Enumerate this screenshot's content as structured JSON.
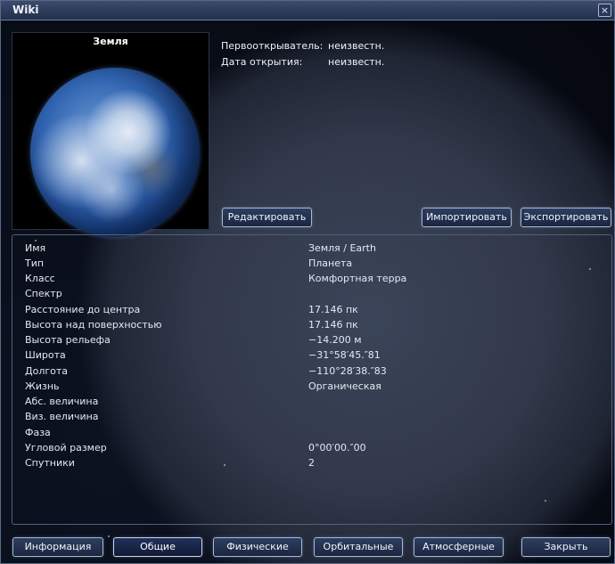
{
  "window": {
    "title": "Wiki",
    "close_label": "×"
  },
  "image": {
    "label": "Земля"
  },
  "meta": [
    {
      "key": "Первооткрыватель:",
      "value": "неизвестн."
    },
    {
      "key": "Дата открытия:",
      "value": "неизвестн."
    }
  ],
  "toolbar": {
    "edit_label": "Редактировать",
    "import_label": "Импортировать",
    "export_label": "Экспортировать"
  },
  "properties": [
    {
      "key": "Имя",
      "value": "Земля / Earth"
    },
    {
      "key": "Тип",
      "value": "Планета"
    },
    {
      "key": "Класс",
      "value": "Комфортная терра"
    },
    {
      "key": "Спектр",
      "value": ""
    },
    {
      "key": "Расстояние до центра",
      "value": "17.146 пк"
    },
    {
      "key": "Высота над поверхностью",
      "value": "17.146 пк"
    },
    {
      "key": "Высота рельефа",
      "value": "−14.200 м"
    },
    {
      "key": "Широта",
      "value": "−31°58′45.″81"
    },
    {
      "key": "Долгота",
      "value": "−110°28′38.″83"
    },
    {
      "key": "Жизнь",
      "value": "Органическая"
    },
    {
      "key": "Абс. величина",
      "value": ""
    },
    {
      "key": "Виз. величина",
      "value": ""
    },
    {
      "key": "Фаза",
      "value": ""
    },
    {
      "key": "Угловой размер",
      "value": "0°00′00.″00"
    },
    {
      "key": "Спутники",
      "value": "2"
    }
  ],
  "tabs": [
    {
      "label": "Информация",
      "active": false
    },
    {
      "label": "Общие",
      "active": true
    },
    {
      "label": "Физические",
      "active": false
    },
    {
      "label": "Орбитальные",
      "active": false
    },
    {
      "label": "Атмосферные",
      "active": false
    }
  ],
  "footer": {
    "close_label": "Закрыть"
  }
}
